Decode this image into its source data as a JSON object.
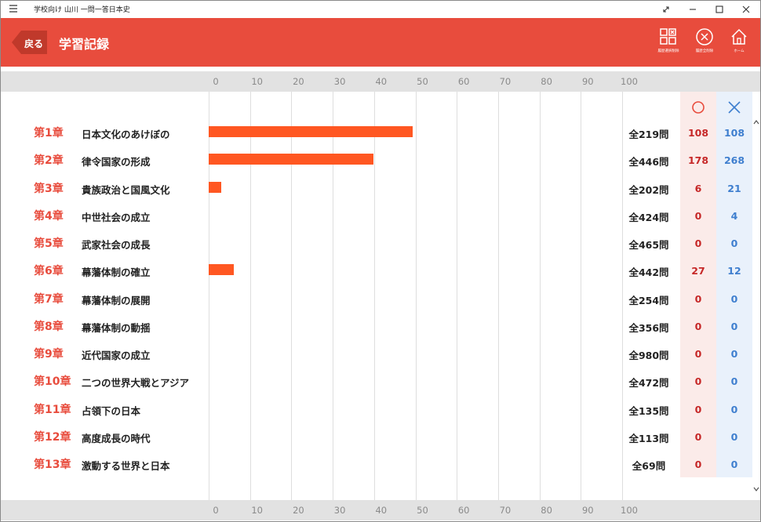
{
  "window": {
    "title": "学校向け 山川 一問一答日本史",
    "icons": [
      "hamburger-icon",
      "expand-icon",
      "minimize-icon",
      "maximize-icon",
      "close-icon"
    ]
  },
  "header": {
    "back_label": "戻る",
    "title": "学習記録",
    "tools": [
      {
        "name": "selected-history-delete",
        "label": "履歴選択削除",
        "icon": "grid-delete-icon"
      },
      {
        "name": "all-history-delete",
        "label": "履歴全削除",
        "icon": "circle-x-icon"
      },
      {
        "name": "home",
        "label": "ホーム",
        "icon": "home-icon"
      }
    ],
    "accent": "#e84c3d"
  },
  "columns": {
    "correct_symbol": "○",
    "wrong_symbol": "×",
    "correct_color": "#c62828",
    "wrong_color": "#3f7fcf"
  },
  "chart_data": {
    "type": "bar",
    "orientation": "horizontal",
    "xlim": [
      0,
      100
    ],
    "ticks": [
      "0",
      "10",
      "20",
      "30",
      "40",
      "50",
      "60",
      "70",
      "80",
      "90",
      "100"
    ],
    "bar_color": "#ff5722",
    "rows": [
      {
        "chapter": "第1章",
        "title": "日本文化のあけぼの",
        "value": 49.3,
        "total": "全219問",
        "correct": "108",
        "wrong": "108"
      },
      {
        "chapter": "第2章",
        "title": "律令国家の形成",
        "value": 39.9,
        "total": "全446問",
        "correct": "178",
        "wrong": "268"
      },
      {
        "chapter": "第3章",
        "title": "貴族政治と国風文化",
        "value": 3.0,
        "total": "全202問",
        "correct": "6",
        "wrong": "21"
      },
      {
        "chapter": "第4章",
        "title": "中世社会の成立",
        "value": 0,
        "total": "全424問",
        "correct": "0",
        "wrong": "4"
      },
      {
        "chapter": "第5章",
        "title": "武家社会の成長",
        "value": 0,
        "total": "全465問",
        "correct": "0",
        "wrong": "0"
      },
      {
        "chapter": "第6章",
        "title": "幕藩体制の確立",
        "value": 6.1,
        "total": "全442問",
        "correct": "27",
        "wrong": "12"
      },
      {
        "chapter": "第7章",
        "title": "幕藩体制の展開",
        "value": 0,
        "total": "全254問",
        "correct": "0",
        "wrong": "0"
      },
      {
        "chapter": "第8章",
        "title": "幕藩体制の動揺",
        "value": 0,
        "total": "全356問",
        "correct": "0",
        "wrong": "0"
      },
      {
        "chapter": "第9章",
        "title": "近代国家の成立",
        "value": 0,
        "total": "全980問",
        "correct": "0",
        "wrong": "0"
      },
      {
        "chapter": "第10章",
        "title": "二つの世界大戦とアジア",
        "value": 0,
        "total": "全472問",
        "correct": "0",
        "wrong": "0"
      },
      {
        "chapter": "第11章",
        "title": "占領下の日本",
        "value": 0,
        "total": "全135問",
        "correct": "0",
        "wrong": "0"
      },
      {
        "chapter": "第12章",
        "title": "高度成長の時代",
        "value": 0,
        "total": "全113問",
        "correct": "0",
        "wrong": "0"
      },
      {
        "chapter": "第13章",
        "title": "激動する世界と日本",
        "value": 0,
        "total": "全69問",
        "correct": "0",
        "wrong": "0"
      }
    ]
  }
}
